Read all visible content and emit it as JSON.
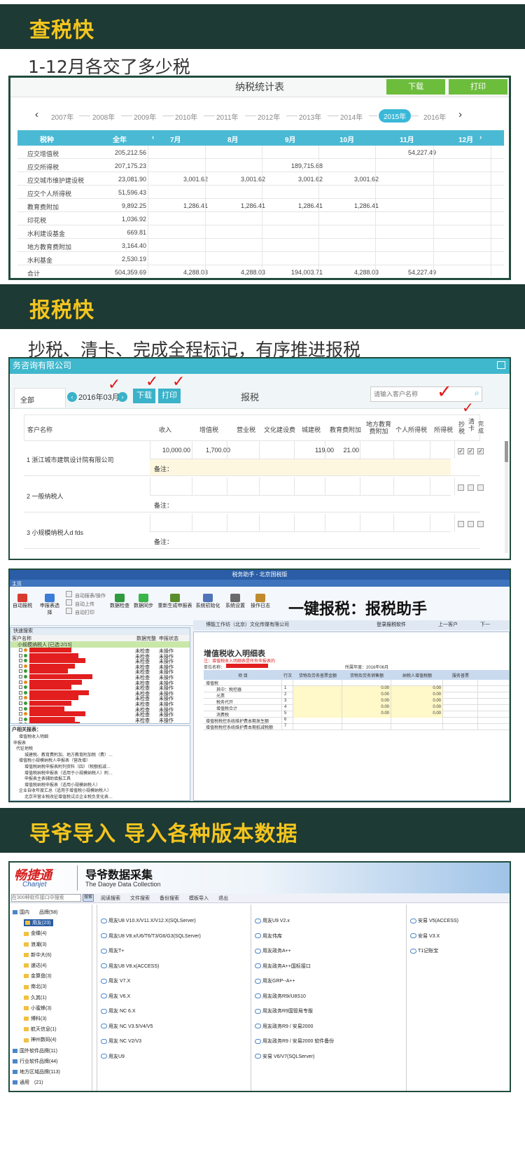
{
  "sections": [
    {
      "banner": "查税快",
      "subtitle": "1-12月各交了多少税"
    },
    {
      "banner": "报税快",
      "subtitle": "抄税、清卡、完成全程标记，有序推进报税"
    },
    {
      "banner": "导爷导入 导入各种版本数据"
    }
  ],
  "stats": {
    "title": "纳税统计表",
    "download": "下载",
    "print": "打印",
    "years": [
      "2007年",
      "2008年",
      "2009年",
      "2010年",
      "2011年",
      "2012年",
      "2013年",
      "2014年",
      "2015年",
      "2016年"
    ],
    "active_year": "2015年",
    "prev": "‹",
    "next": "›",
    "headers": [
      "税种",
      "全年",
      "7月",
      "8月",
      "9月",
      "10月",
      "11月",
      "12月"
    ],
    "rows": [
      [
        "应交增值税",
        "205,212.56",
        "",
        "",
        "",
        "",
        "54,227.49",
        ""
      ],
      [
        "应交所得税",
        "207,175.23",
        "",
        "",
        "189,715.68",
        "",
        "",
        ""
      ],
      [
        "应交城市维护建设税",
        "23,081.90",
        "3,001.62",
        "3,001.62",
        "3,001.62",
        "3,001.62",
        "",
        ""
      ],
      [
        "应交个人所得税",
        "51,596.43",
        "",
        "",
        "",
        "",
        "",
        ""
      ],
      [
        "教育费附加",
        "9,892.25",
        "1,286.41",
        "1,286.41",
        "1,286.41",
        "1,286.41",
        "",
        ""
      ],
      [
        "印花税",
        "1,036.92",
        "",
        "",
        "",
        "",
        "",
        ""
      ],
      [
        "水利建设基金",
        "669.81",
        "",
        "",
        "",
        "",
        "",
        ""
      ],
      [
        "地方教育费附加",
        "3,164.40",
        "",
        "",
        "",
        "",
        "",
        ""
      ],
      [
        "水利基金",
        "2,530.19",
        "",
        "",
        "",
        "",
        "",
        ""
      ],
      [
        "合计",
        "504,359.69",
        "4,288.03",
        "4,288.03",
        "194,003.71",
        "4,288.03",
        "54,227.49",
        ""
      ]
    ]
  },
  "filing": {
    "company": "务咨询有限公司",
    "tab": "全部",
    "month": "2016年03月",
    "download": "下载",
    "print": "打印",
    "title": "报税",
    "search_placeholder": "请输入客户名称",
    "headers": [
      "客户名称",
      "收入",
      "增值税",
      "营业税",
      "文化建设费",
      "城建税",
      "教育费附加",
      "地方教育费附加",
      "个人所得税",
      "所得税",
      "抄税",
      "清卡",
      "完成"
    ],
    "clients": [
      {
        "name": "1 浙江城市建筑设计院有限公司",
        "income": "10,000.00",
        "vat": "1,700.00",
        "urban": "119.00",
        "edu": "21.00",
        "note": "备注："
      },
      {
        "name": "2 一般纳税人",
        "note": "备注："
      },
      {
        "name": "3 小规模纳税人d fds",
        "note": "备注："
      }
    ]
  },
  "assistant": {
    "window_title": "税务助手 - 北京国税版",
    "menu_home": "主页",
    "slogan": "一键报税：报税助手",
    "toolbar": [
      "自动报税",
      "申报表选择",
      "数据检查",
      "数据同步",
      "重新生成申报表",
      "系统初始化",
      "系统设置",
      "操作日志"
    ],
    "options": [
      "自动报表/操作",
      "自动上传",
      "自动打印"
    ],
    "search": "快速搜索",
    "tree_header": [
      "客户名称",
      "数据完整",
      "申报状态"
    ],
    "group": "小规模纳税人 [已选:2/15]",
    "status_a": "未检查",
    "status_b": "未操作",
    "company_bar": "博能工作坊（北京）文化传媒有限公司",
    "login": "登录报税软件",
    "prev_client": "上一客户",
    "next_client": "下一",
    "form_title": "增值税收入明细表",
    "form_note": "注：增值税收入明细表是所有申报表的",
    "unit": "单位名称：",
    "period": "所属年度：2016年06月",
    "form_cols": [
      "项 目",
      "行次",
      "货物及劳务普票金额",
      "货物及劳务销售额",
      "纳税人增值税额",
      "服务普票"
    ],
    "form_rows": [
      [
        "增值税",
        "",
        "",
        "",
        "",
        ""
      ],
      [
        "其中：税控器",
        "1",
        "",
        "0.00",
        "0.00",
        ""
      ],
      [
        "光票",
        "2",
        "",
        "0.00",
        "0.00",
        ""
      ],
      [
        "税务代开",
        "3",
        "",
        "0.00",
        "0.00",
        ""
      ],
      [
        "增值税合计",
        "4",
        "",
        "0.00",
        "0.00",
        ""
      ],
      [
        "消费税",
        "5",
        "",
        "0.00",
        "0.00",
        ""
      ],
      [
        "增值税税控系统维护费本期发生额",
        "6",
        "",
        "",
        "",
        ""
      ],
      [
        "增值税税控系统维护费本期抵减税额",
        "7",
        "",
        "",
        "",
        ""
      ]
    ],
    "bottom_header": "户相关报表：",
    "tree2": [
      "增值税收入明细",
      "申报表",
      "代征地税",
      "城建税、教育费附加、地方教育附加税（费）…",
      "增值税小规模纳税人申报表（营改增）",
      "增值税纳税申报表附列资料（四）（税额抵减…",
      "增值税纳税申报表（适用于小规模纳税人）附…",
      "申报表主表辅助填报工具",
      "增值税纳税申报表（适用小规模纳税人）",
      "企业自收年度汇总（适用于增值税小规模纳税人）",
      "北京市营业税改征增值税试点企业税负变化表…"
    ]
  },
  "daoye": {
    "brand": "畅捷通",
    "brand_en": "Chanjet",
    "title": "导爷数据采集",
    "title_en": "The Daoye Data Collection",
    "search_placeholder": "在300种软件接口中搜索",
    "search_btn": "搜索",
    "menu": [
      "阅读搜索",
      "文件搜索",
      "备份搜索",
      "模板导入",
      "退出"
    ],
    "tree": [
      "国内　　品牌(58)",
      "用友(23)",
      "金蝶(4)",
      "浪潮(3)",
      "新中大(6)",
      "速达(4)",
      "金算盘(3)",
      "南北(3)",
      "久其(1)",
      "小蜜蜂(3)",
      "博科(3)",
      "航天信息(1)",
      "神州数码(4)",
      "国外软件品牌(11)",
      "行业软件品牌(44)",
      "地方区域品牌(113)",
      "通用　(21)"
    ],
    "col1": [
      "用友U8 V10.X/V11.X/V12.X(SQLServer)",
      "用友U8 V8.x/U6/T6/T3/G6/G3(SQLServer)",
      "用友T+",
      "用友U8 V8.x(ACCESS)",
      "用友 V7.X",
      "用友 V6.X",
      "用友 NC 6.X",
      "用友 NC V3.5/V4/V5",
      "用友 NC V2/V3",
      "用友U9"
    ],
    "col2": [
      "用友U9 V2.x",
      "用友伟库",
      "用友政务A++",
      "用友政务A++国标接口",
      "用友GRP--A++",
      "用友政务R9i/U8S10",
      "用友政务R9国管局专版",
      "用友政务R9 / 安易2000",
      "用友政务R9 / 安易2000 软件备份",
      "安易 V6/V7(SQLServer)"
    ],
    "col3": [
      "安易 V5(ACCESS)",
      "安易 V3.X",
      "T1记账宝"
    ]
  }
}
